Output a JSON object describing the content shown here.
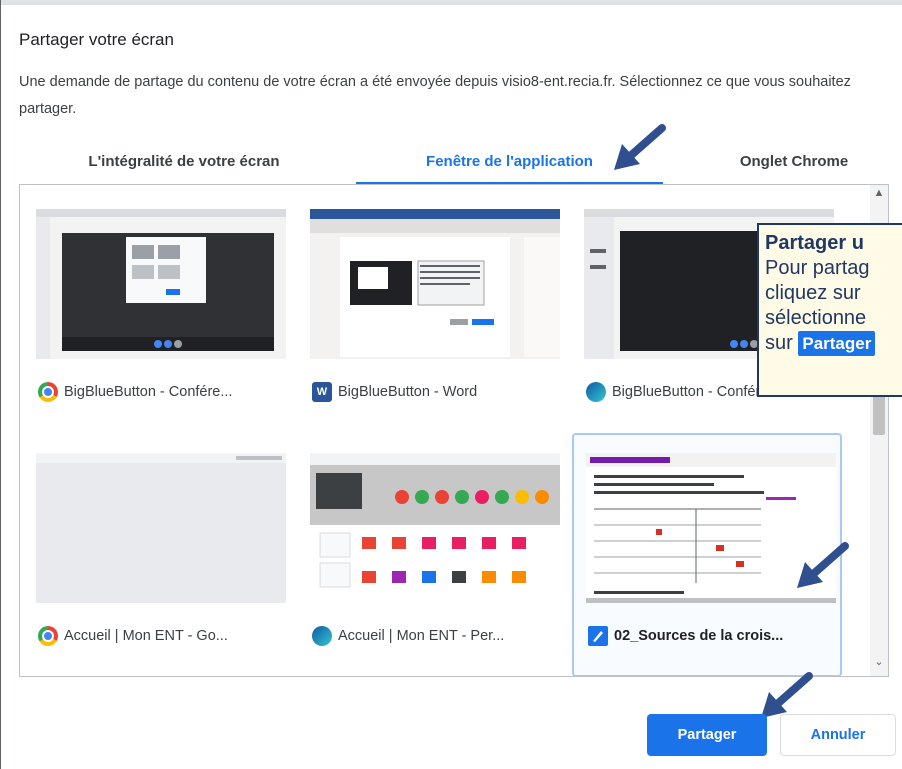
{
  "dialog": {
    "title": "Partager votre écran",
    "description": "Une demande de partage du contenu de votre écran a été envoyée depuis visio8-ent.recia.fr. Sélectionnez ce que vous souhaitez partager."
  },
  "tabs": [
    {
      "label": "L'intégralité de votre écran",
      "active": false
    },
    {
      "label": "Fenêtre de l'application",
      "active": true
    },
    {
      "label": "Onglet Chrome",
      "active": false
    }
  ],
  "windows": [
    {
      "label": "BigBlueButton - Confére...",
      "icon": "chrome-icon",
      "selected": false
    },
    {
      "label": "BigBlueButton - Word",
      "icon": "word-icon",
      "selected": false
    },
    {
      "label": "BigBlueButton - Confére...",
      "icon": "edge-icon",
      "selected": false
    },
    {
      "label": "Accueil | Mon ENT - Go...",
      "icon": "chrome-icon",
      "selected": false
    },
    {
      "label": "Accueil | Mon ENT - Per...",
      "icon": "edge-icon",
      "selected": false
    },
    {
      "label": "02_Sources de la crois...",
      "icon": "notes-icon",
      "selected": true
    }
  ],
  "tooltip": {
    "title": "Partager u",
    "line1": "Pour partag",
    "line2": "cliquez sur",
    "line3": "sélectionne",
    "line4_prefix": "sur",
    "line4_pill": "Partager"
  },
  "buttons": {
    "share": "Partager",
    "cancel": "Annuler"
  },
  "colors": {
    "accent": "#1a73e8",
    "annotation_arrow": "#2f4f8f",
    "tooltip_border": "#1f3864"
  }
}
